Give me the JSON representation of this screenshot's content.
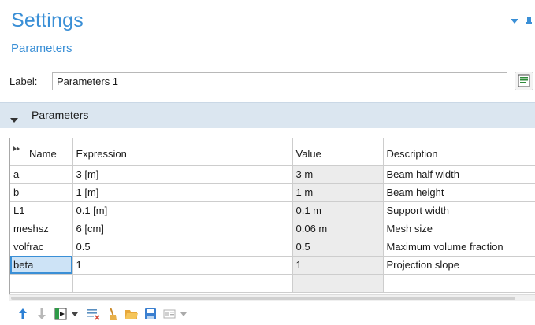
{
  "header": {
    "title": "Settings",
    "subtitle": "Parameters"
  },
  "label_field": {
    "label": "Label:",
    "value": "Parameters 1"
  },
  "section": {
    "title": "Parameters"
  },
  "table": {
    "columns": [
      "Name",
      "Expression",
      "Value",
      "Description"
    ],
    "rows": [
      {
        "name": "a",
        "expression": "3 [m]",
        "value": "3 m",
        "description": "Beam half width"
      },
      {
        "name": "b",
        "expression": "1 [m]",
        "value": "1 m",
        "description": "Beam height"
      },
      {
        "name": "L1",
        "expression": "0.1 [m]",
        "value": "0.1 m",
        "description": "Support width"
      },
      {
        "name": "meshsz",
        "expression": "6 [cm]",
        "value": "0.06 m",
        "description": "Mesh size"
      },
      {
        "name": "volfrac",
        "expression": "0.5",
        "value": "0.5",
        "description": "Maximum volume fraction"
      },
      {
        "name": "beta",
        "expression": "1",
        "value": "1",
        "description": "Projection slope"
      }
    ],
    "selected_row": 5
  },
  "toolbar": {
    "icons": [
      "move-up-icon",
      "move-down-icon",
      "add-parameter-icon",
      "delete-icon",
      "clear-icon",
      "load-from-file-icon",
      "save-to-file-icon",
      "create-selection-icon"
    ]
  },
  "colors": {
    "accent": "#3a8fd6",
    "section_bg": "#dbe6f0",
    "value_cell_bg": "#ececec",
    "selected_cell_bg": "#cde3f6"
  }
}
